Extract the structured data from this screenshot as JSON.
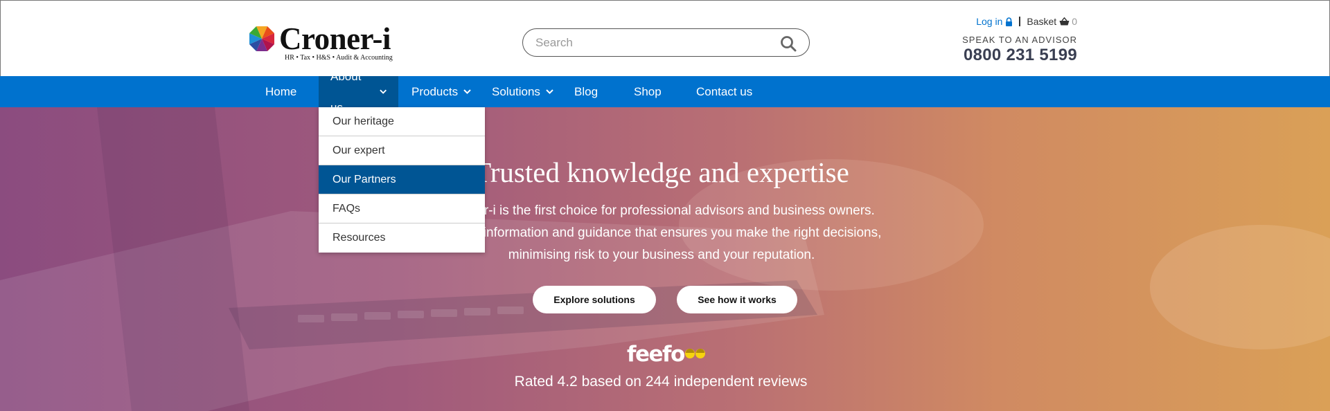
{
  "brand": {
    "name": "Croner-i",
    "tagline": "HR • Tax • H&S • Audit & Accounting"
  },
  "search": {
    "placeholder": "Search"
  },
  "account": {
    "login_label": "Log in",
    "basket_label": "Basket",
    "basket_count": "0"
  },
  "advisor": {
    "label": "SPEAK TO AN ADVISOR",
    "phone": "0800 231 5199"
  },
  "nav": {
    "items": [
      {
        "label": "Home"
      },
      {
        "label": "About us"
      },
      {
        "label": "Products"
      },
      {
        "label": "Solutions"
      },
      {
        "label": "Blog"
      },
      {
        "label": "Shop"
      },
      {
        "label": "Contact us"
      }
    ]
  },
  "dropdown": {
    "items": [
      {
        "label": "Our heritage"
      },
      {
        "label": "Our expert"
      },
      {
        "label": "Our Partners"
      },
      {
        "label": "FAQs"
      },
      {
        "label": "Resources"
      }
    ]
  },
  "hero": {
    "title": "Trusted knowledge and expertise",
    "line1": "Croner-i is the first choice for professional advisors and business owners.",
    "line2": "Online information and guidance that ensures you make the right decisions,",
    "line3": "minimising risk to your business and your reputation.",
    "cta_primary": "Explore solutions",
    "cta_secondary": "See how it works",
    "feefo_logo": "feefo",
    "rating_text": "Rated 4.2 based on 244 independent reviews"
  },
  "colors": {
    "nav_blue": "#0072ce",
    "nav_active": "#005594",
    "link_blue": "#0072ce",
    "phone_text": "#3a3f52"
  }
}
